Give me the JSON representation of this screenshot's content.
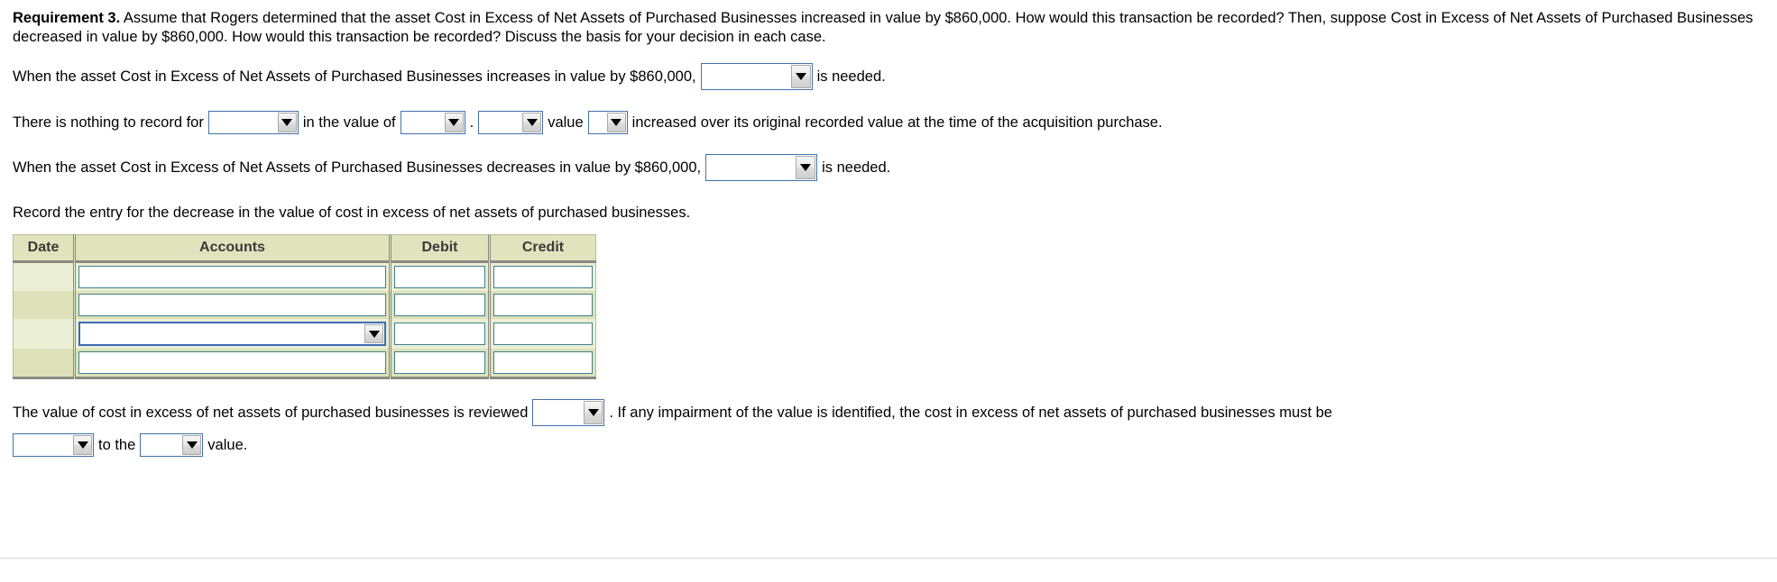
{
  "requirement": {
    "label": "Requirement 3.",
    "body": "Assume that Rogers determined that the asset Cost in Excess of Net Assets of Purchased Businesses increased in value by $860,000. How would this transaction be recorded? Then, suppose Cost in Excess of Net Assets of Purchased Businesses decreased in value by $860,000. How would this transaction be recorded? Discuss the basis for your decision in each case."
  },
  "statement_increase": {
    "text_before": "When the asset Cost in Excess of Net Assets of Purchased Businesses increases in value by $860,000,",
    "dropdown_value": "",
    "text_after": "is needed."
  },
  "statement_nothing": {
    "text_1": "There is nothing to record for",
    "dropdown_1": "",
    "text_2": "in the value of",
    "dropdown_2": "",
    "text_3": ".",
    "dropdown_3": "",
    "text_4": "value",
    "dropdown_4": "",
    "text_5": "increased over its original recorded value at the time of the acquisition purchase."
  },
  "statement_decrease": {
    "text_before": "When the asset Cost in Excess of Net Assets of Purchased Businesses decreases in value by $860,000,",
    "dropdown_value": "",
    "text_after": "is needed."
  },
  "record_instruction": "Record the entry for the decrease in the value of cost in excess of net assets of purchased businesses.",
  "journal": {
    "columns": [
      "Date",
      "Accounts",
      "Debit",
      "Credit"
    ],
    "rows": [
      {
        "date": "",
        "accounts": "",
        "debit": "",
        "credit": "",
        "accounts_type": "input"
      },
      {
        "date": "",
        "accounts": "",
        "debit": "",
        "credit": "",
        "accounts_type": "input"
      },
      {
        "date": "",
        "accounts": "",
        "debit": "",
        "credit": "",
        "accounts_type": "select"
      },
      {
        "date": "",
        "accounts": "",
        "debit": "",
        "credit": "",
        "accounts_type": "input"
      }
    ]
  },
  "statement_review": {
    "text_1": "The value of cost in excess of net assets of purchased businesses is reviewed",
    "dropdown_1": "",
    "text_2": ". If any impairment of the value is identified, the cost in excess of net assets of purchased businesses must be",
    "dropdown_2": "",
    "text_3": "to the",
    "dropdown_3": "",
    "text_4": "value."
  },
  "colors": {
    "header_fill": "#dfe4bc",
    "row_light": "#eaefd5",
    "row_dark": "#dde2ba",
    "cell_border": "#3f7f8f",
    "focus_border": "#3b6cb5",
    "select_border": "#4472a8"
  }
}
